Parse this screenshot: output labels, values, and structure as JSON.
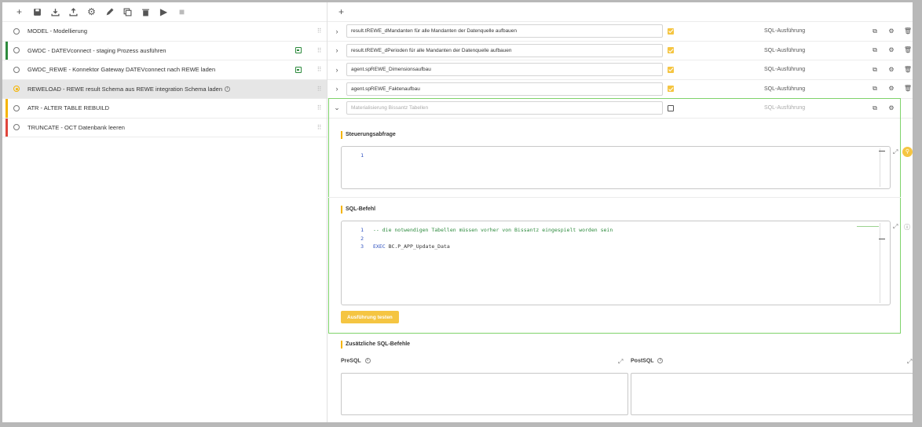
{
  "left_toolbar": {
    "icons": [
      "add-icon",
      "save-icon",
      "download-icon",
      "upload-icon",
      "gear-icon",
      "edit-icon",
      "copy-icon",
      "delete-icon",
      "play-icon",
      "stop-icon"
    ]
  },
  "steps": [
    {
      "name": "MODEL - Modellierung",
      "bar": "",
      "calendar": false,
      "selected": false
    },
    {
      "name": "GWDC - DATEVconnect - staging Prozess ausführen",
      "bar": "#2e8b3e",
      "calendar": true,
      "selected": false
    },
    {
      "name": "GWDC_REWE - Konnektor Gateway DATEVconnect nach REWE laden",
      "bar": "",
      "calendar": true,
      "selected": false
    },
    {
      "name": "REWELOAD - REWE result Schema aus REWE integration Schema laden",
      "bar": "",
      "calendar": false,
      "selected": true,
      "info": true
    },
    {
      "name": "ATR - ALTER TABLE REBUILD",
      "bar": "#f5b400",
      "calendar": false,
      "selected": false
    },
    {
      "name": "TRUNCATE - OCT Datenbank leeren",
      "bar": "#e0463c",
      "calendar": false,
      "selected": false
    }
  ],
  "statements": [
    {
      "text": "result.tREWE_dMandanten für alle Mandanten der Datenquelle aufbauen",
      "checked": true,
      "type": "SQL-Ausführung"
    },
    {
      "text": "result.tREWE_dPerioden für alle Mandanten der Datenquelle aufbauen",
      "checked": true,
      "type": "SQL-Ausführung"
    },
    {
      "text": "agent.spREWE_Dimensionsaufbau",
      "checked": true,
      "type": "SQL-Ausführung"
    },
    {
      "text": "agent.spREWE_Faktenaufbau",
      "checked": true,
      "type": "SQL-Ausführung"
    },
    {
      "text": "Materialisierung Bissantz Tabellen",
      "checked": false,
      "type": "SQL-Ausführung",
      "expanded": true
    }
  ],
  "detail": {
    "steuerung_label": "Steuerungsabfrage",
    "steuerung_lines": [
      "1"
    ],
    "sql_label": "SQL-Befehl",
    "sql_line_numbers": [
      "1",
      "2",
      "3"
    ],
    "sql_line1": "-- die notwendigen Tabellen müssen vorher von Bissantz eingespielt worden sein",
    "sql_line3_kw": "EXEC",
    "sql_line3_rest": " BC.P_APP_Update_Data",
    "run_button": "Ausführung testen",
    "extra_label": "Zusätzliche SQL-Befehle",
    "presql_label": "PreSQL",
    "postsql_label": "PostSQL"
  },
  "colors": {
    "accent": "#f5c542",
    "highlight": "#7fd36b"
  }
}
